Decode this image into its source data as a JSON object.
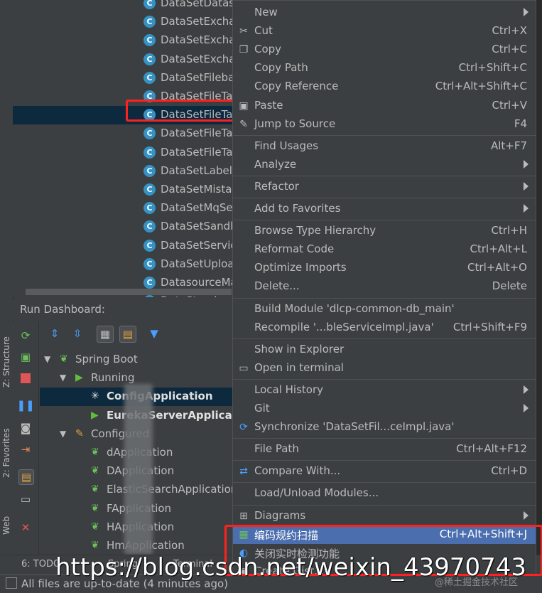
{
  "tree": {
    "items": [
      {
        "label": "DataSetDatasourceImpl"
      },
      {
        "label": "DataSetExchan"
      },
      {
        "label": "DataSetExchan"
      },
      {
        "label": "DataSetExchan"
      },
      {
        "label": "DataSetFileba"
      },
      {
        "label": "DataSetFileTal"
      },
      {
        "label": "DataSetFileTal",
        "selected": true
      },
      {
        "label": "DataSetFileTal"
      },
      {
        "label": "DataSetFileTal"
      },
      {
        "label": "DataSetLabelS"
      },
      {
        "label": "DataSetMistak"
      },
      {
        "label": "DataSetMqSe"
      },
      {
        "label": "DataSetSandb"
      },
      {
        "label": "DataSetServic"
      },
      {
        "label": "DataSetUploa"
      },
      {
        "label": "DatasourceMa"
      },
      {
        "label": "DataStandard"
      }
    ],
    "class_icon": "C"
  },
  "dashboard": {
    "title": "Run Dashboard:",
    "nodes": [
      {
        "label": "Spring Boot",
        "indent": 0,
        "arrow": "▼",
        "icon": "spring-icon"
      },
      {
        "label": "Running",
        "indent": 1,
        "arrow": "▼",
        "icon": "run-icon"
      },
      {
        "label": "ConfigApplication",
        "indent": 2,
        "arrow": "",
        "icon": "spinner-icon",
        "bold": true,
        "selected": true
      },
      {
        "label": "EurekaServerApplication",
        "indent": 2,
        "arrow": "",
        "icon": "run-icon",
        "bold": true
      },
      {
        "label": "Configured",
        "indent": 1,
        "arrow": "▼",
        "icon": "wrench-icon"
      },
      {
        "label": "dApplication",
        "indent": 2,
        "arrow": "",
        "icon": "spring-icon"
      },
      {
        "label": "DApplication",
        "indent": 2,
        "arrow": "",
        "icon": "spring-icon"
      },
      {
        "label": "ElasticSearchApplication",
        "indent": 2,
        "arrow": "",
        "icon": "spring-icon"
      },
      {
        "label": "FApplication",
        "indent": 2,
        "arrow": "",
        "icon": "spring-icon"
      },
      {
        "label": "HApplication",
        "indent": 2,
        "arrow": "",
        "icon": "spring-icon"
      },
      {
        "label": "HmApplication",
        "indent": 2,
        "arrow": "",
        "icon": "spring-icon"
      }
    ]
  },
  "left_tabs": {
    "structure": "Z: Structure",
    "favorites": "2: Favorites",
    "web": "Web"
  },
  "bottom": {
    "todo": "6: TODO",
    "spring": "Spring",
    "terminal": "Terminal",
    "status": "All files are up-to-date (4 minutes ago)"
  },
  "menu": {
    "items": [
      {
        "label": "New",
        "shortcut": "",
        "submenu": true,
        "icon": ""
      },
      {
        "label": "Cut",
        "shortcut": "Ctrl+X",
        "icon": "scissors-icon"
      },
      {
        "label": "Copy",
        "shortcut": "Ctrl+C",
        "icon": "copy-icon"
      },
      {
        "label": "Copy Path",
        "shortcut": "Ctrl+Shift+C",
        "icon": ""
      },
      {
        "label": "Copy Reference",
        "shortcut": "Ctrl+Alt+Shift+C",
        "icon": ""
      },
      {
        "label": "Paste",
        "shortcut": "Ctrl+V",
        "icon": "paste-icon"
      },
      {
        "label": "Jump to Source",
        "shortcut": "F4",
        "icon": "edit-icon"
      },
      {
        "sep": true
      },
      {
        "label": "Find Usages",
        "shortcut": "Alt+F7",
        "icon": ""
      },
      {
        "label": "Analyze",
        "shortcut": "",
        "submenu": true,
        "icon": ""
      },
      {
        "sep": true
      },
      {
        "label": "Refactor",
        "shortcut": "",
        "submenu": true,
        "icon": ""
      },
      {
        "sep": true
      },
      {
        "label": "Add to Favorites",
        "shortcut": "",
        "submenu": true,
        "icon": ""
      },
      {
        "sep": true
      },
      {
        "label": "Browse Type Hierarchy",
        "shortcut": "Ctrl+H",
        "icon": ""
      },
      {
        "label": "Reformat Code",
        "shortcut": "Ctrl+Alt+L",
        "icon": ""
      },
      {
        "label": "Optimize Imports",
        "shortcut": "Ctrl+Alt+O",
        "icon": ""
      },
      {
        "label": "Delete...",
        "shortcut": "Delete",
        "icon": ""
      },
      {
        "sep": true
      },
      {
        "label": "Build Module 'dlcp-common-db_main'",
        "shortcut": "",
        "icon": ""
      },
      {
        "label": "Recompile '...bleServiceImpl.java'",
        "shortcut": "Ctrl+Shift+F9",
        "icon": ""
      },
      {
        "sep": true
      },
      {
        "label": "Show in Explorer",
        "shortcut": "",
        "icon": ""
      },
      {
        "label": "Open in terminal",
        "shortcut": "",
        "icon": "terminal-icon"
      },
      {
        "sep": true
      },
      {
        "label": "Local History",
        "shortcut": "",
        "submenu": true,
        "icon": ""
      },
      {
        "label": "Git",
        "shortcut": "",
        "submenu": true,
        "icon": ""
      },
      {
        "label": "Synchronize 'DataSetFil...ceImpl.java'",
        "shortcut": "",
        "icon": "sync-icon"
      },
      {
        "sep": true
      },
      {
        "label": "File Path",
        "shortcut": "Ctrl+Alt+F12",
        "icon": ""
      },
      {
        "sep": true
      },
      {
        "label": "Compare With...",
        "shortcut": "Ctrl+D",
        "icon": "compare-icon"
      },
      {
        "sep": true
      },
      {
        "label": "Load/Unload Modules...",
        "shortcut": "",
        "icon": ""
      },
      {
        "sep": true
      },
      {
        "label": "Diagrams",
        "shortcut": "",
        "submenu": true,
        "icon": "diagram-icon"
      },
      {
        "label": "编码规约扫描",
        "shortcut": "Ctrl+Alt+Shift+J",
        "icon": "scan-icon",
        "highlighted": true
      },
      {
        "label": "关闭实时检测功能",
        "shortcut": "",
        "icon": "realtime-icon"
      },
      {
        "label": "Create Gist...",
        "shortcut": "",
        "icon": "gist-icon"
      }
    ]
  },
  "watermark": "https://blog.csdn.net/weixin_43970743",
  "watermark_small": "@稀土掘金技术社区",
  "colors": {
    "background": "#3c3f41",
    "selection": "#0d293e",
    "menu_highlight": "#4b6eaf",
    "annotation_red": "#ff2020"
  }
}
